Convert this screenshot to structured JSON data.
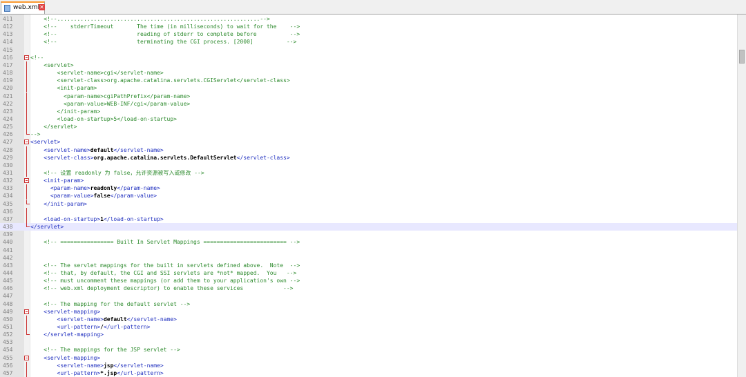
{
  "tab": {
    "filename": "web.xml",
    "close_glyph": "✕",
    "icon": "xml-file-icon"
  },
  "colors": {
    "tag": "#1f2fbf",
    "comment": "#2e8b2e",
    "text": "#000000",
    "current_line": "#e8e8ff",
    "fold_marker": "#cc3333",
    "active_tab_accent": "#fa9a30"
  },
  "editor": {
    "current_line": "438",
    "lines": [
      {
        "n": "411",
        "parts": [
          [
            "ws",
            "    "
          ],
          [
            "comment",
            "<!--.............................................................-->"
          ]
        ]
      },
      {
        "n": "412",
        "parts": [
          [
            "ws",
            "    "
          ],
          [
            "comment",
            "<!--    stderrTimeout       The time (in milliseconds) to wait for the    -->"
          ]
        ]
      },
      {
        "n": "413",
        "parts": [
          [
            "ws",
            "    "
          ],
          [
            "comment",
            "<!--                        reading of stderr to complete before          -->"
          ]
        ]
      },
      {
        "n": "414",
        "parts": [
          [
            "ws",
            "    "
          ],
          [
            "comment",
            "<!--                        terminating the CGI process. [2000]          -->"
          ]
        ]
      },
      {
        "n": "415",
        "parts": []
      },
      {
        "n": "416",
        "fold": "box",
        "parts": [
          [
            "comment",
            "<!--"
          ]
        ]
      },
      {
        "n": "417",
        "fold": "line",
        "parts": [
          [
            "ws",
            "    "
          ],
          [
            "comment",
            "<servlet>"
          ]
        ]
      },
      {
        "n": "418",
        "fold": "line",
        "parts": [
          [
            "ws",
            "        "
          ],
          [
            "comment",
            "<servlet-name>cgi</servlet-name>"
          ]
        ]
      },
      {
        "n": "419",
        "fold": "line",
        "parts": [
          [
            "ws",
            "        "
          ],
          [
            "comment",
            "<servlet-class>org.apache.catalina.servlets.CGIServlet</servlet-class>"
          ]
        ]
      },
      {
        "n": "420",
        "fold": "line",
        "parts": [
          [
            "ws",
            "        "
          ],
          [
            "comment",
            "<init-param>"
          ]
        ]
      },
      {
        "n": "421",
        "fold": "line",
        "parts": [
          [
            "ws",
            "          "
          ],
          [
            "comment",
            "<param-name>cgiPathPrefix</param-name>"
          ]
        ]
      },
      {
        "n": "422",
        "fold": "line",
        "parts": [
          [
            "ws",
            "          "
          ],
          [
            "comment",
            "<param-value>WEB-INF/cgi</param-value>"
          ]
        ]
      },
      {
        "n": "423",
        "fold": "line",
        "parts": [
          [
            "ws",
            "        "
          ],
          [
            "comment",
            "</init-param>"
          ]
        ]
      },
      {
        "n": "424",
        "fold": "line",
        "parts": [
          [
            "ws",
            "        "
          ],
          [
            "comment",
            "<load-on-startup>5</load-on-startup>"
          ]
        ]
      },
      {
        "n": "425",
        "fold": "line",
        "parts": [
          [
            "ws",
            "    "
          ],
          [
            "comment",
            "</servlet>"
          ]
        ]
      },
      {
        "n": "426",
        "fold": "tail",
        "parts": [
          [
            "comment",
            "-->"
          ]
        ]
      },
      {
        "n": "427",
        "fold": "box",
        "parts": [
          [
            "tag",
            "<servlet>"
          ]
        ]
      },
      {
        "n": "428",
        "fold": "line",
        "parts": [
          [
            "ws",
            "    "
          ],
          [
            "tag",
            "<servlet-name>"
          ],
          [
            "text",
            "default"
          ],
          [
            "tag",
            "</servlet-name>"
          ]
        ]
      },
      {
        "n": "429",
        "fold": "line",
        "parts": [
          [
            "ws",
            "    "
          ],
          [
            "tag",
            "<servlet-class>"
          ],
          [
            "text",
            "org.apache.catalina.servlets.DefaultServlet"
          ],
          [
            "tag",
            "</servlet-class>"
          ]
        ]
      },
      {
        "n": "430",
        "fold": "line",
        "parts": []
      },
      {
        "n": "431",
        "fold": "line",
        "parts": [
          [
            "ws",
            "    "
          ],
          [
            "comment",
            "<!-- 设置 readonly 为 false，允许资源被写入或修改 -->"
          ]
        ]
      },
      {
        "n": "432",
        "fold": "box",
        "parts": [
          [
            "ws",
            "    "
          ],
          [
            "tag",
            "<init-param>"
          ]
        ]
      },
      {
        "n": "433",
        "fold": "line",
        "parts": [
          [
            "ws",
            "      "
          ],
          [
            "tag",
            "<param-name>"
          ],
          [
            "text",
            "readonly"
          ],
          [
            "tag",
            "</param-name>"
          ]
        ]
      },
      {
        "n": "434",
        "fold": "line",
        "parts": [
          [
            "ws",
            "      "
          ],
          [
            "tag",
            "<param-value>"
          ],
          [
            "text",
            "false"
          ],
          [
            "tag",
            "</param-value>"
          ]
        ]
      },
      {
        "n": "435",
        "fold": "tail",
        "parts": [
          [
            "ws",
            "    "
          ],
          [
            "tag",
            "</init-param>"
          ]
        ]
      },
      {
        "n": "436",
        "fold": "line",
        "parts": []
      },
      {
        "n": "437",
        "fold": "line",
        "parts": [
          [
            "ws",
            "    "
          ],
          [
            "tag",
            "<load-on-startup>"
          ],
          [
            "text",
            "1"
          ],
          [
            "tag",
            "</load-on-startup>"
          ]
        ]
      },
      {
        "n": "438",
        "fold": "tail",
        "parts": [
          [
            "tag",
            "</servlet>"
          ]
        ]
      },
      {
        "n": "439",
        "parts": []
      },
      {
        "n": "440",
        "parts": [
          [
            "ws",
            "    "
          ],
          [
            "comment",
            "<!-- ================ Built In Servlet Mappings ========================= -->"
          ]
        ]
      },
      {
        "n": "441",
        "parts": []
      },
      {
        "n": "442",
        "parts": []
      },
      {
        "n": "443",
        "parts": [
          [
            "ws",
            "    "
          ],
          [
            "comment",
            "<!-- The servlet mappings for the built in servlets defined above.  Note  -->"
          ]
        ]
      },
      {
        "n": "444",
        "parts": [
          [
            "ws",
            "    "
          ],
          [
            "comment",
            "<!-- that, by default, the CGI and SSI servlets are *not* mapped.  You   -->"
          ]
        ]
      },
      {
        "n": "445",
        "parts": [
          [
            "ws",
            "    "
          ],
          [
            "comment",
            "<!-- must uncomment these mappings (or add them to your application's own -->"
          ]
        ]
      },
      {
        "n": "446",
        "parts": [
          [
            "ws",
            "    "
          ],
          [
            "comment",
            "<!-- web.xml deployment descriptor) to enable these services            -->"
          ]
        ]
      },
      {
        "n": "447",
        "parts": []
      },
      {
        "n": "448",
        "parts": [
          [
            "ws",
            "    "
          ],
          [
            "comment",
            "<!-- The mapping for the default servlet -->"
          ]
        ]
      },
      {
        "n": "449",
        "fold": "box",
        "parts": [
          [
            "ws",
            "    "
          ],
          [
            "tag",
            "<servlet-mapping>"
          ]
        ]
      },
      {
        "n": "450",
        "fold": "line",
        "parts": [
          [
            "ws",
            "        "
          ],
          [
            "tag",
            "<servlet-name>"
          ],
          [
            "text",
            "default"
          ],
          [
            "tag",
            "</servlet-name>"
          ]
        ]
      },
      {
        "n": "451",
        "fold": "line",
        "parts": [
          [
            "ws",
            "        "
          ],
          [
            "tag",
            "<url-pattern>"
          ],
          [
            "text",
            "/"
          ],
          [
            "tag",
            "</url-pattern>"
          ]
        ]
      },
      {
        "n": "452",
        "fold": "tail",
        "parts": [
          [
            "ws",
            "    "
          ],
          [
            "tag",
            "</servlet-mapping>"
          ]
        ]
      },
      {
        "n": "453",
        "parts": []
      },
      {
        "n": "454",
        "parts": [
          [
            "ws",
            "    "
          ],
          [
            "comment",
            "<!-- The mappings for the JSP servlet -->"
          ]
        ]
      },
      {
        "n": "455",
        "fold": "box",
        "parts": [
          [
            "ws",
            "    "
          ],
          [
            "tag",
            "<servlet-mapping>"
          ]
        ]
      },
      {
        "n": "456",
        "fold": "line",
        "parts": [
          [
            "ws",
            "        "
          ],
          [
            "tag",
            "<servlet-name>"
          ],
          [
            "text",
            "jsp"
          ],
          [
            "tag",
            "</servlet-name>"
          ]
        ]
      },
      {
        "n": "457",
        "fold": "line",
        "parts": [
          [
            "ws",
            "        "
          ],
          [
            "tag",
            "<url-pattern>"
          ],
          [
            "text",
            "*.jsp"
          ],
          [
            "tag",
            "</url-pattern>"
          ]
        ]
      }
    ]
  }
}
